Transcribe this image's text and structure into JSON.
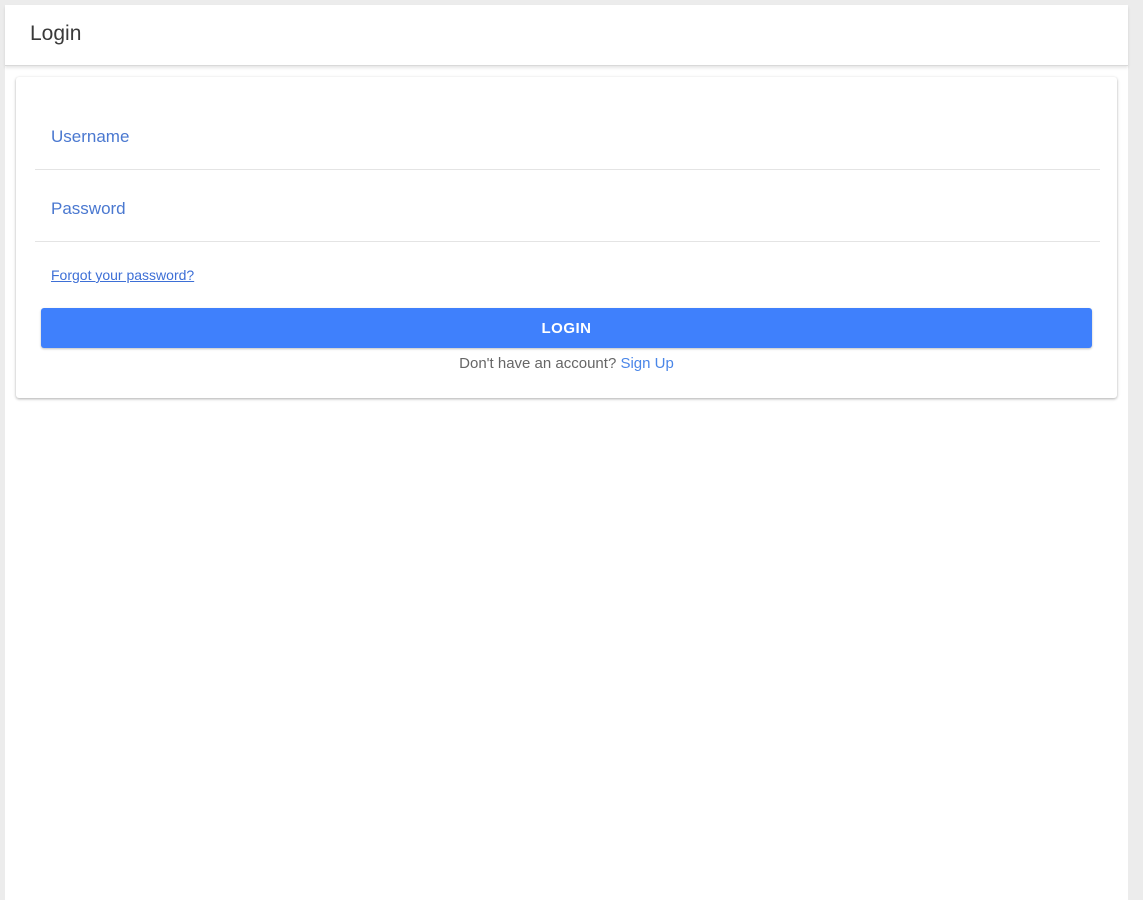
{
  "header": {
    "title": "Login"
  },
  "form": {
    "username_placeholder": "Username",
    "username_value": "",
    "password_placeholder": "Password",
    "password_value": "",
    "forgot_link": "Forgot your password?",
    "login_button": "LOGIN",
    "signup_prompt": "Don't have an account?",
    "signup_link": "Sign Up"
  },
  "colors": {
    "primary": "#3f80fc",
    "link": "#3d6fd6",
    "background": "#ececec"
  }
}
